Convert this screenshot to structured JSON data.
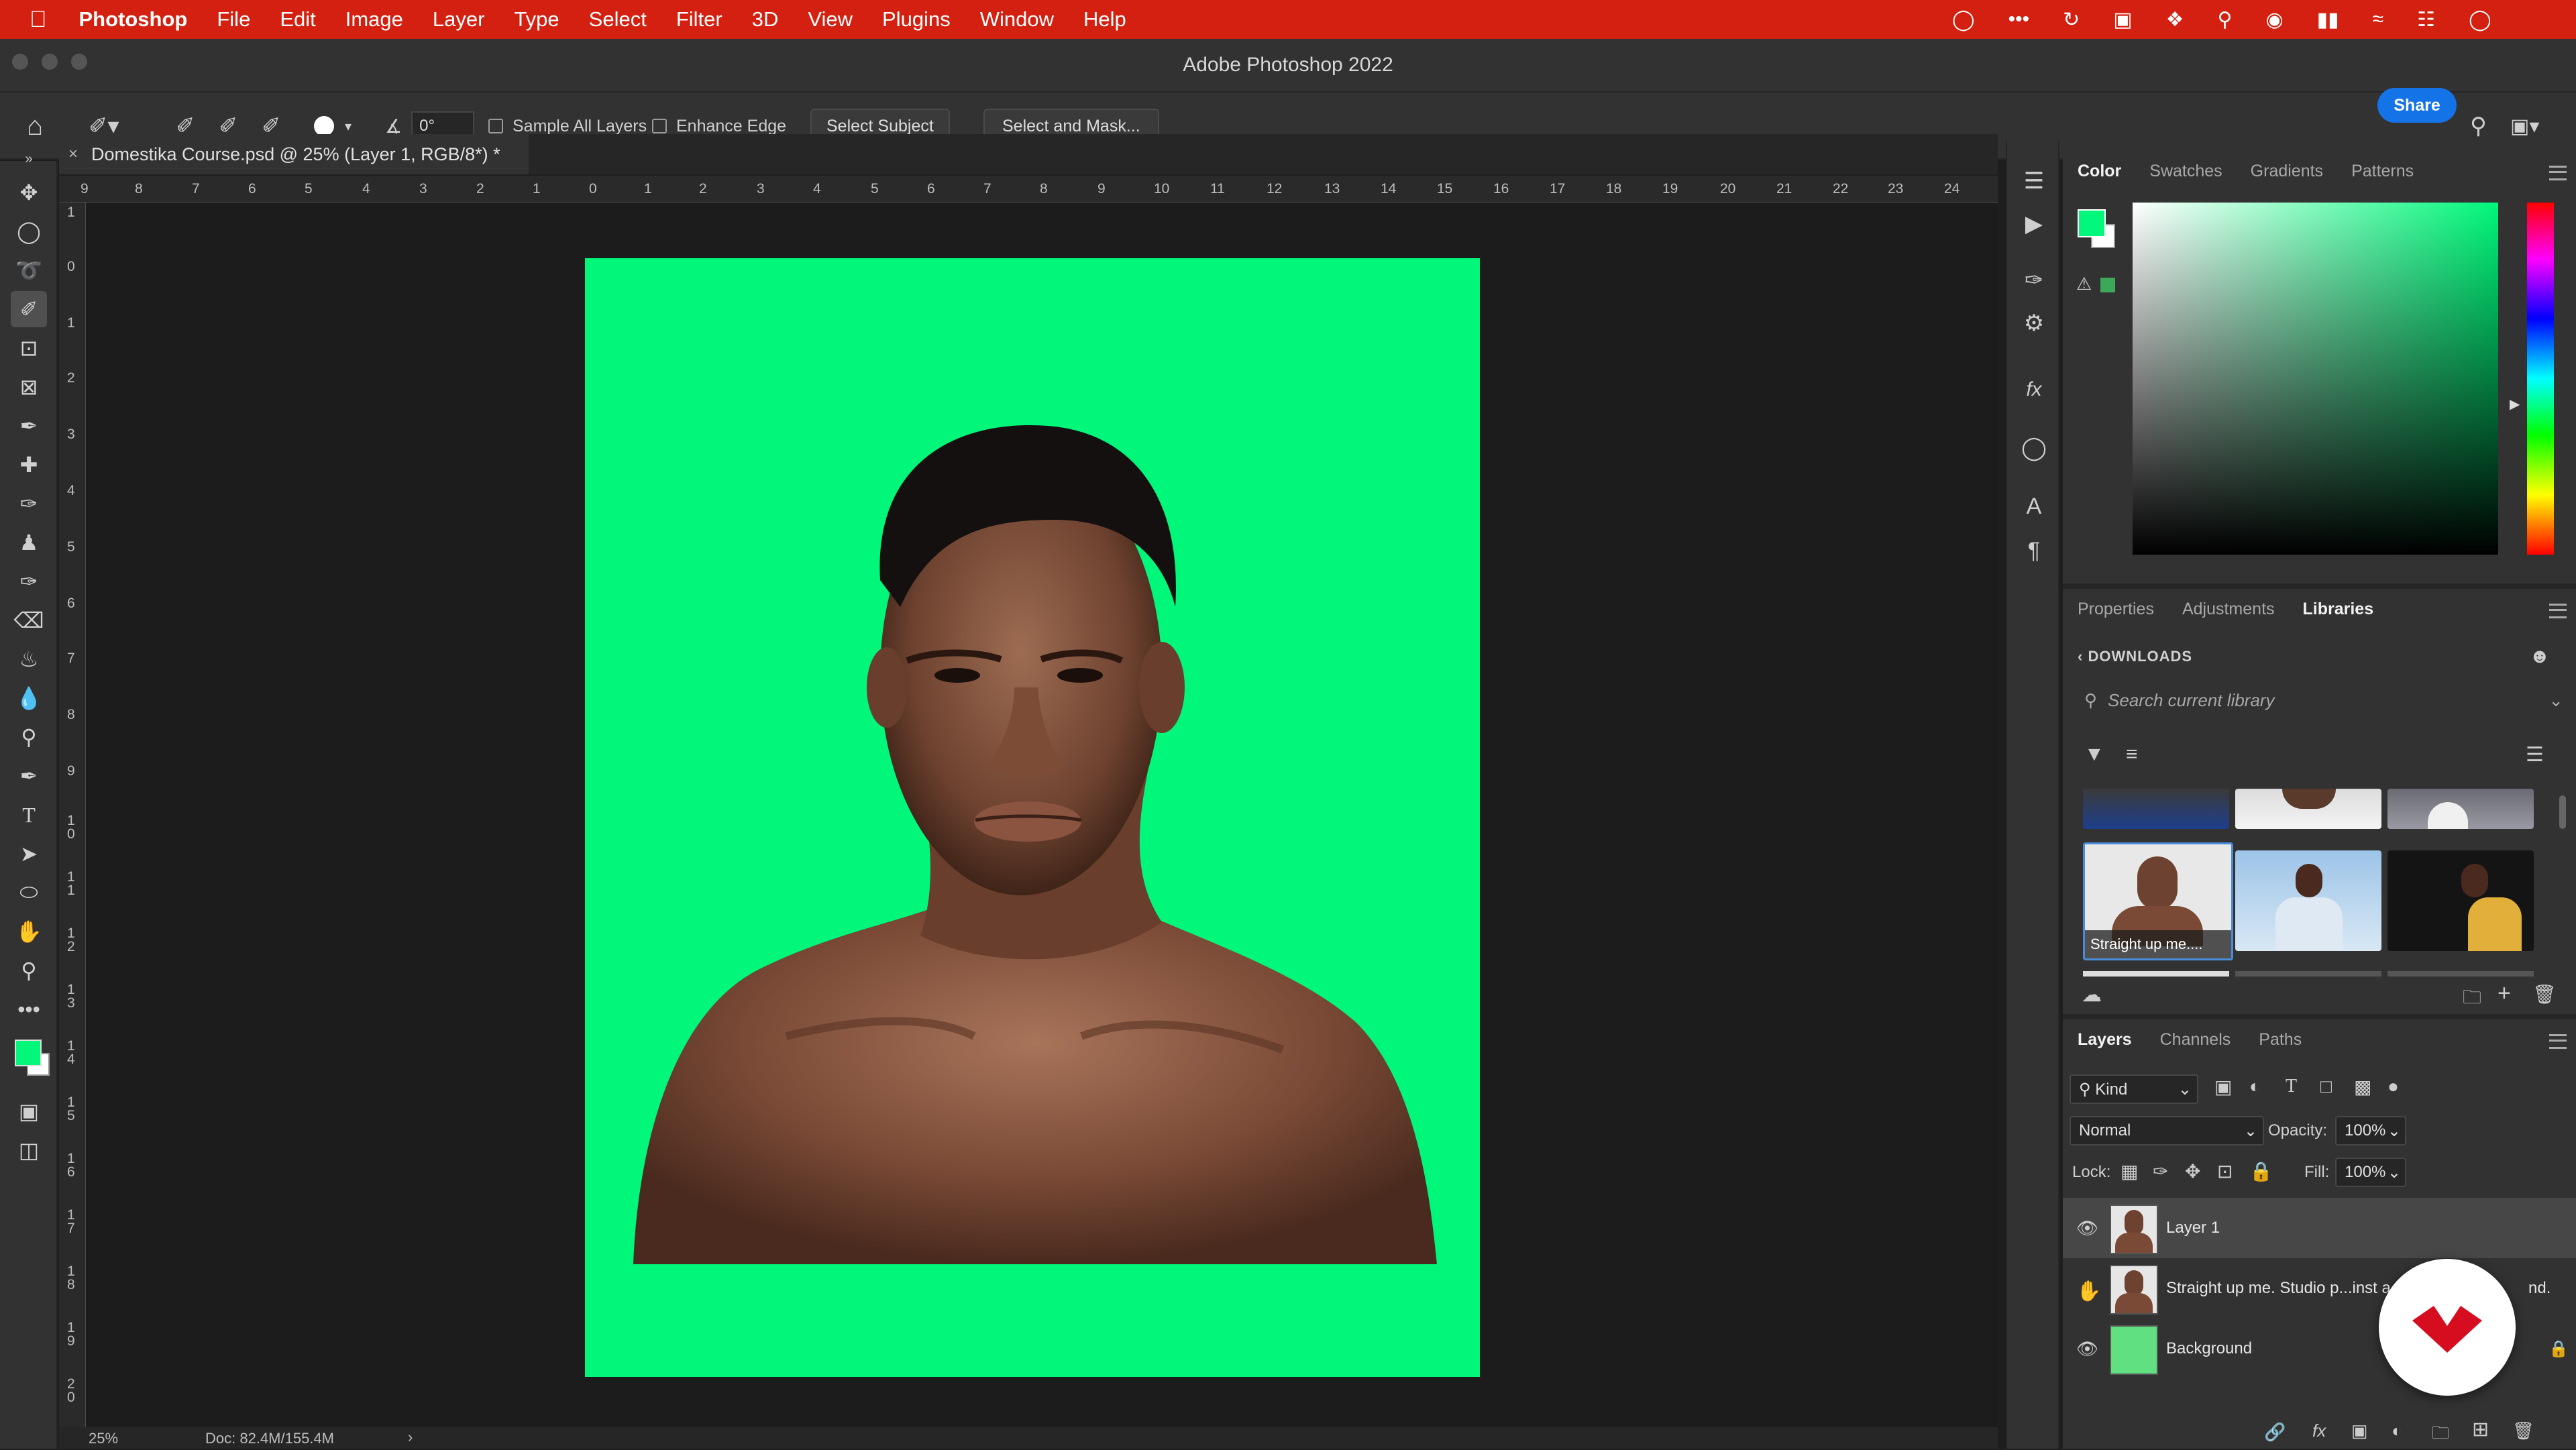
{
  "menubar": {
    "apple_icon": "apple-icon",
    "app_name": "Photoshop",
    "items": [
      "File",
      "Edit",
      "Image",
      "Layer",
      "Type",
      "Select",
      "Filter",
      "3D",
      "View",
      "Plugins",
      "Window",
      "Help"
    ]
  },
  "window": {
    "title": "Adobe Photoshop 2022"
  },
  "options": {
    "brush_size": "40",
    "angle": "0°",
    "sample_all_layers": "Sample All Layers",
    "enhance_edge": "Enhance Edge",
    "select_subject": "Select Subject",
    "select_and_mask": "Select and Mask...",
    "share": "Share"
  },
  "document": {
    "tab_title": "Domestika Course.psd @ 25% (Layer 1, RGB/8*) *",
    "zoom": "25%",
    "doc_info": "Doc: 82.4M/155.4M",
    "canvas_color": "#00f77a"
  },
  "rulers": {
    "horizontal": [
      "9",
      "8",
      "7",
      "6",
      "5",
      "4",
      "3",
      "2",
      "1",
      "0",
      "1",
      "2",
      "3",
      "4",
      "5",
      "6",
      "7",
      "8",
      "9",
      "10",
      "11",
      "12",
      "13",
      "14",
      "15",
      "16",
      "17",
      "18",
      "19",
      "20",
      "21",
      "22",
      "23",
      "24"
    ],
    "vertical": [
      "1",
      "0",
      "1",
      "2",
      "3",
      "4",
      "5",
      "6",
      "7",
      "8",
      "9",
      "1\n0",
      "1\n1",
      "1\n2",
      "1\n3",
      "1\n4",
      "1\n5",
      "1\n6",
      "1\n7",
      "1\n8",
      "1\n9",
      "2\n0"
    ]
  },
  "color_panel": {
    "tabs": [
      "Color",
      "Swatches",
      "Gradients",
      "Patterns"
    ],
    "foreground": "#00f77a",
    "background": "#ffffff"
  },
  "libraries_panel": {
    "tabs": [
      "Properties",
      "Adjustments",
      "Libraries"
    ],
    "location": "DOWNLOADS",
    "search_placeholder": "Search current library",
    "selected_item_label": "Straight up me...."
  },
  "layers_panel": {
    "tabs": [
      "Layers",
      "Channels",
      "Paths"
    ],
    "filter_kind": "Kind",
    "blend_mode": "Normal",
    "opacity_label": "Opacity:",
    "opacity": "100%",
    "lock_label": "Lock:",
    "fill_label": "Fill:",
    "fill": "100%",
    "layers": [
      {
        "name": "Layer 1",
        "visible": true,
        "selected": true
      },
      {
        "name": "Straight up me. Studio p...inst a",
        "suffix": "nd.",
        "visible": false,
        "selected": false
      },
      {
        "name": "Background",
        "visible": true,
        "selected": false
      }
    ]
  }
}
